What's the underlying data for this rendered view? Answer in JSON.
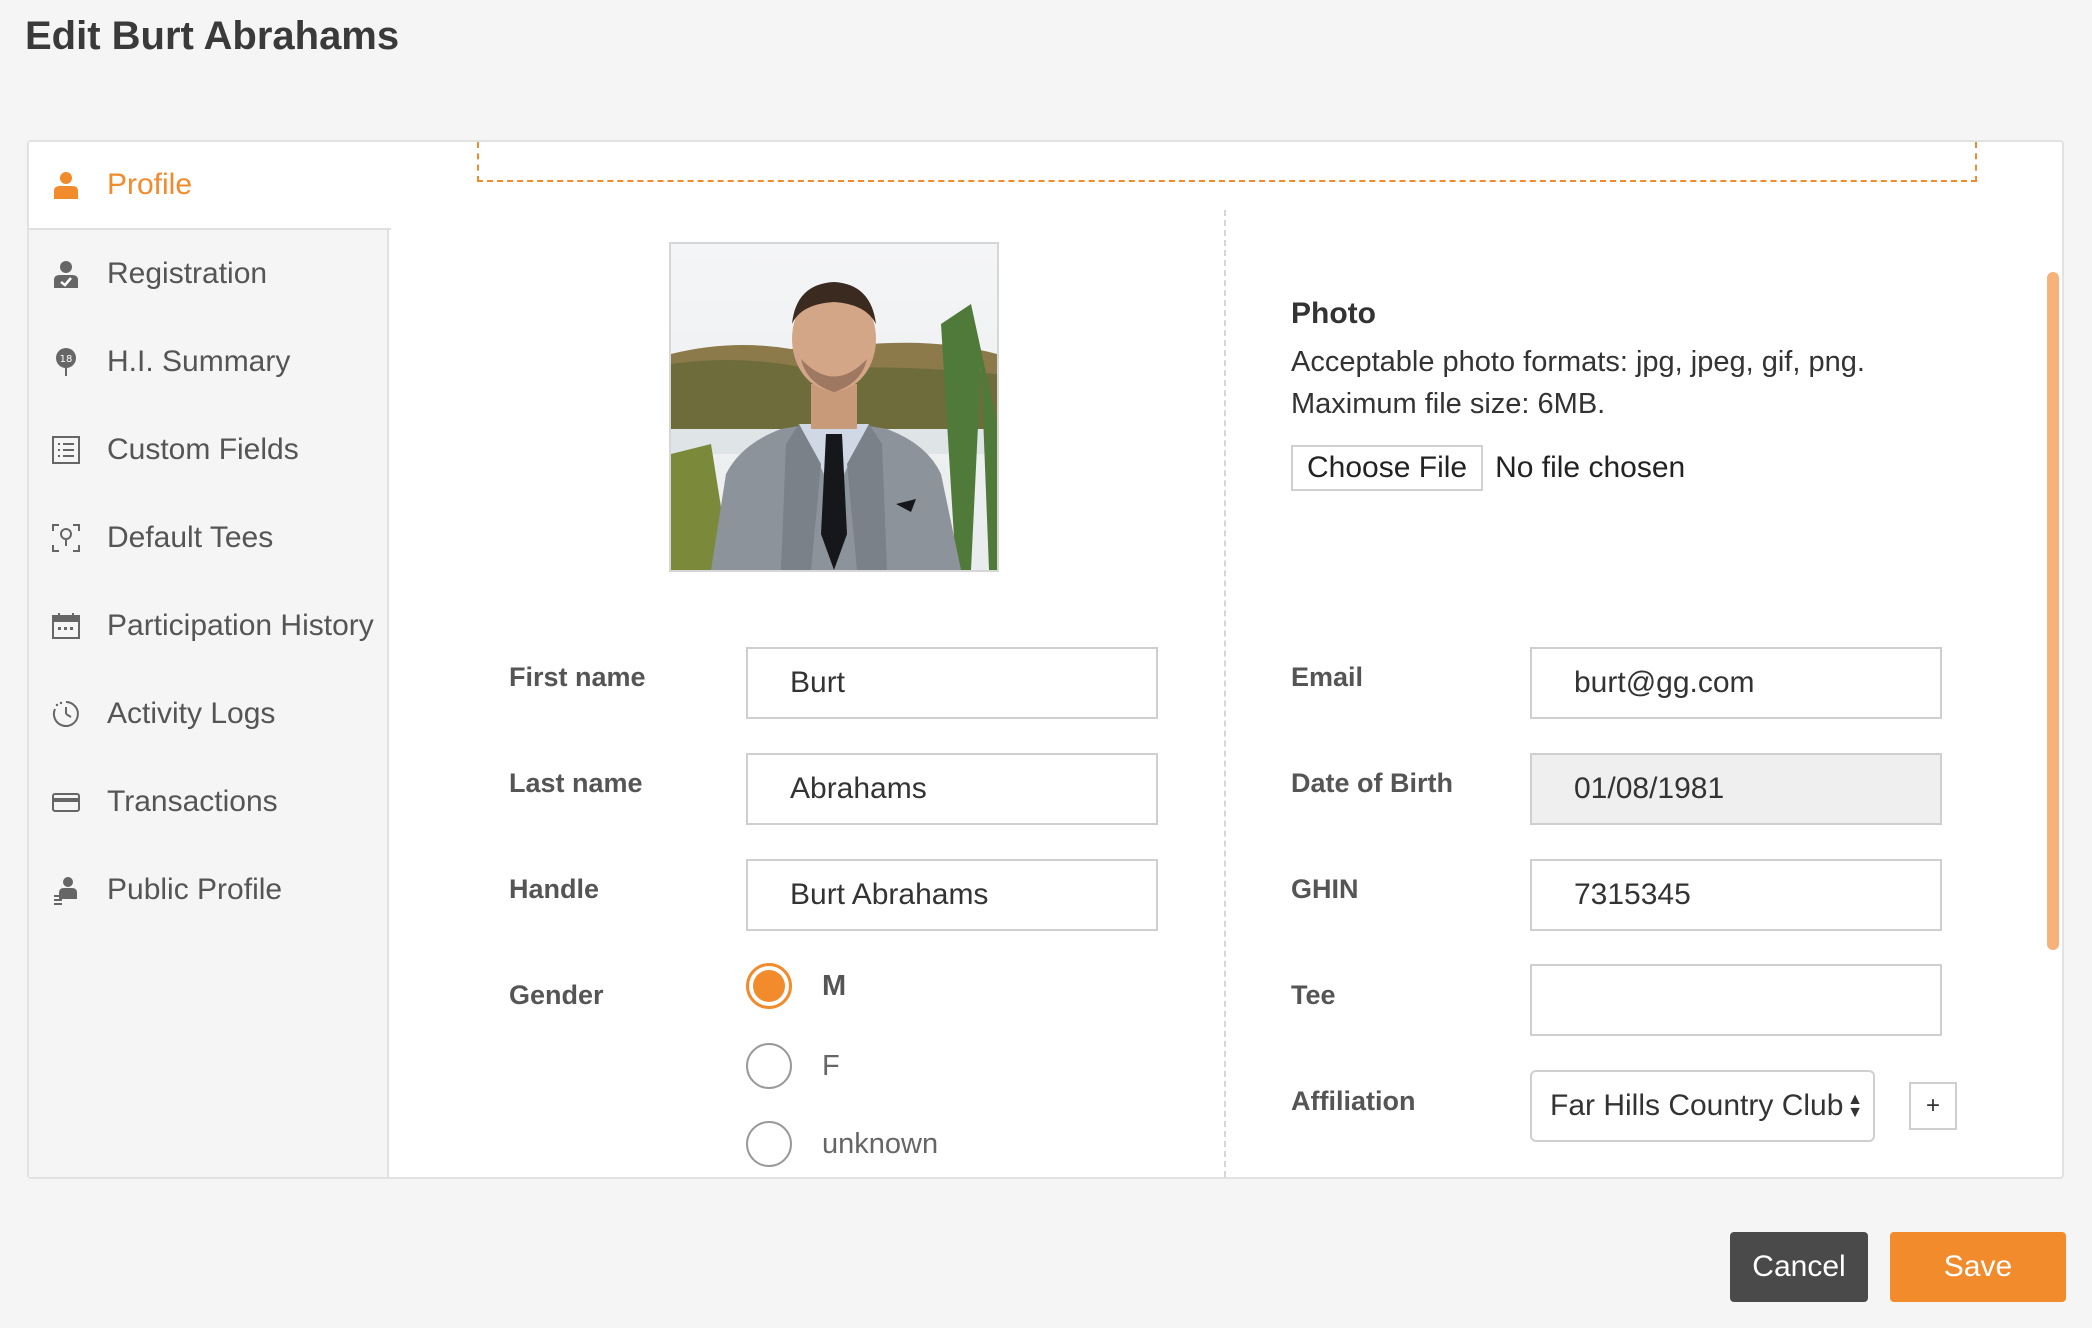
{
  "page": {
    "title": "Edit Burt Abrahams"
  },
  "sidebar": {
    "items": [
      {
        "label": "Profile",
        "icon": "person-icon",
        "active": true
      },
      {
        "label": "Registration",
        "icon": "person-check-icon"
      },
      {
        "label": "H.I. Summary",
        "icon": "hole-18-flag-icon"
      },
      {
        "label": "Custom Fields",
        "icon": "list-icon"
      },
      {
        "label": "Default Tees",
        "icon": "tee-icon"
      },
      {
        "label": "Participation History",
        "icon": "calendar-icon"
      },
      {
        "label": "Activity Logs",
        "icon": "clock-icon"
      },
      {
        "label": "Transactions",
        "icon": "credit-card-icon"
      },
      {
        "label": "Public Profile",
        "icon": "person-public-icon"
      }
    ]
  },
  "photo": {
    "title": "Photo",
    "formats": "Acceptable photo formats: jpg, jpeg, gif, png.",
    "max_size": "Maximum file size: 6MB.",
    "choose_label": "Choose File",
    "file_status": "No file chosen"
  },
  "form": {
    "first_name": {
      "label": "First name",
      "value": "Burt"
    },
    "last_name": {
      "label": "Last name",
      "value": "Abrahams"
    },
    "handle": {
      "label": "Handle",
      "value": "Burt Abrahams"
    },
    "gender": {
      "label": "Gender",
      "options": [
        "M",
        "F",
        "unknown"
      ],
      "selected": "M"
    },
    "email": {
      "label": "Email",
      "value": "burt@gg.com"
    },
    "dob": {
      "label": "Date of Birth",
      "value": "01/08/1981"
    },
    "ghin": {
      "label": "GHIN",
      "value": "7315345"
    },
    "tee": {
      "label": "Tee",
      "value": ""
    },
    "affiliation": {
      "label": "Affiliation",
      "value": "Far Hills Country Club",
      "add_label": "+"
    }
  },
  "actions": {
    "cancel": "Cancel",
    "save": "Save"
  },
  "colors": {
    "accent": "#f18b2c",
    "cancel_bg": "#4a4a4a"
  }
}
